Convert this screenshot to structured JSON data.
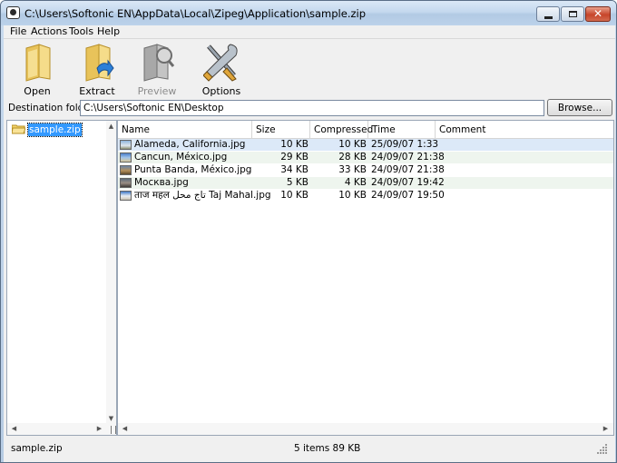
{
  "window": {
    "title": "C:\\Users\\Softonic EN\\AppData\\Local\\Zipeg\\Application\\sample.zip",
    "close_glyph": "✕"
  },
  "menu": [
    "File",
    "Actions",
    "Tools",
    "Help"
  ],
  "toolbar": [
    {
      "label": "Open",
      "icon": "open-folder-icon",
      "enabled": true
    },
    {
      "label": "Extract",
      "icon": "extract-folder-icon",
      "enabled": true
    },
    {
      "label": "Preview",
      "icon": "preview-icon",
      "enabled": false
    },
    {
      "label": "Options",
      "icon": "tools-icon",
      "enabled": true
    }
  ],
  "destination": {
    "label": "Destination folder:",
    "value": "C:\\Users\\Softonic EN\\Desktop",
    "browse_label": "Browse..."
  },
  "tree": {
    "root_label": "sample.zip",
    "icon": "folder-icon"
  },
  "columns": [
    "Name",
    "Size",
    "Compressed",
    "Time",
    "Comment"
  ],
  "files": [
    {
      "name": "Alameda, California.jpg",
      "size": "10 KB",
      "compressed": "10 KB",
      "time": "25/09/07 1:33",
      "comment": ""
    },
    {
      "name": "Cancun, México.jpg",
      "size": "29 KB",
      "compressed": "28 KB",
      "time": "24/09/07 21:38",
      "comment": ""
    },
    {
      "name": "Punta Banda, México.jpg",
      "size": "34 KB",
      "compressed": "33 KB",
      "time": "24/09/07 21:38",
      "comment": ""
    },
    {
      "name": "Москва.jpg",
      "size": "5 KB",
      "compressed": "4 KB",
      "time": "24/09/07 19:42",
      "comment": ""
    },
    {
      "name": "ताज महल تاج محل Taj Mahal.jpg",
      "size": "10 KB",
      "compressed": "10 KB",
      "time": "24/09/07 19:50",
      "comment": ""
    }
  ],
  "status": {
    "left": "sample.zip",
    "center": "5 items  89 KB"
  },
  "colors": {
    "selection": "#3399ff",
    "row_selected": "#dce9f8",
    "row_alt": "#eef5ee",
    "chrome": "#f0f0f0"
  }
}
